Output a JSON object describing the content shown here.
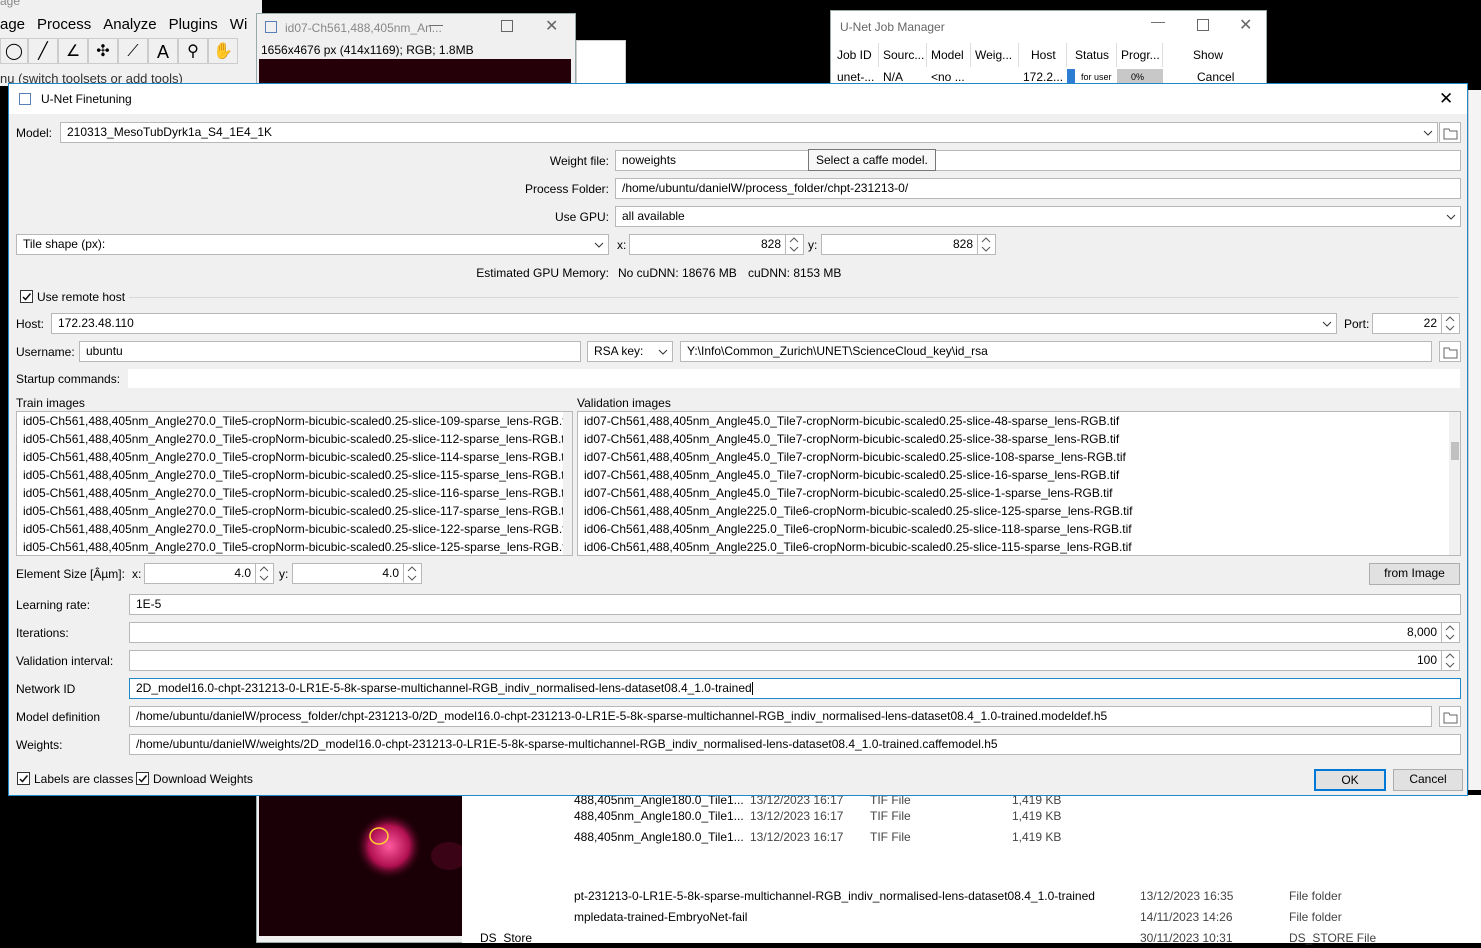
{
  "imagej": {
    "title": "age",
    "menu": [
      "age",
      "Process",
      "Analyze",
      "Plugins",
      "Wi"
    ],
    "status": "nu (switch toolsets or add tools)"
  },
  "image_window": {
    "title": "id07-Ch561,488,405nm_An...",
    "info": "1656x4676 px (414x1169); RGB; 1.8MB"
  },
  "job_manager": {
    "title": "U-Net Job Manager",
    "columns": [
      "Job ID",
      "Sourc...",
      "Model",
      "Weig...",
      "Host",
      "Status",
      "Progr...",
      "Show"
    ],
    "row": [
      "unet-...",
      "N/A",
      "<no ...",
      "",
      "172.2...",
      "for user",
      "0%",
      "Cancel"
    ]
  },
  "file_explorer": {
    "rows": [
      {
        "name": "488,405nm_Angle180.0_Tile1...",
        "date": "13/12/2023 16:17",
        "type": "TIF File",
        "size": "1,419 KB"
      },
      {
        "name": "488,405nm_Angle180.0_Tile1...",
        "date": "13/12/2023 16:17",
        "type": "TIF File",
        "size": "1,419 KB"
      },
      {
        "name": "488,405nm_Angle180.0_Tile1...",
        "date": "13/12/2023 16:17",
        "type": "TIF File",
        "size": "1,419 KB"
      }
    ],
    "folders": [
      {
        "name": "pt-231213-0-LR1E-5-8k-sparse-multichannel-RGB_indiv_normalised-lens-dataset08.4_1.0-trained",
        "date": "13/12/2023 16:35",
        "type": "File folder"
      },
      {
        "name": "mpledata-trained-EmbryoNet-fail",
        "date": "14/11/2023 14:26",
        "type": "File folder"
      },
      {
        "name": "DS_Store",
        "date": "30/11/2023 10:31",
        "type": "DS_STORE File"
      }
    ]
  },
  "dialog": {
    "title": "U-Net Finetuning",
    "model_label": "Model:",
    "model_value": "210313_MesoTubDyrk1a_S4_1E4_1K",
    "weight_file_label": "Weight file:",
    "weight_file_value": "noweights",
    "tooltip": "Select a caffe model.",
    "process_folder_label": "Process Folder:",
    "process_folder_value": "/home/ubuntu/danielW/process_folder/chpt-231213-0/",
    "use_gpu_label": "Use GPU:",
    "use_gpu_value": "all available",
    "tile_shape_value": "Tile shape (px):",
    "x_label": "x:",
    "y_label": "y:",
    "tile_x": "828",
    "tile_y": "828",
    "gpu_memory_label": "Estimated GPU Memory:",
    "gpu_nocudnn": "No cuDNN: 18676 MB",
    "gpu_cudnn": "cuDNN: 8153 MB",
    "use_remote_host_label": "Use remote host",
    "host_label": "Host:",
    "host_value": "172.23.48.110",
    "port_label": "Port:",
    "port_value": "22",
    "username_label": "Username:",
    "username_value": "ubuntu",
    "rsa_key_value": "RSA key:",
    "rsa_path": "Y:\\Info\\Common_Zurich\\UNET\\ScienceCloud_key\\id_rsa",
    "startup_label": "Startup commands:",
    "train_images_label": "Train images",
    "train_images": [
      "id05-Ch561,488,405nm_Angle270.0_Tile5-cropNorm-bicubic-scaled0.25-slice-109-sparse_lens-RGB.tif",
      "id05-Ch561,488,405nm_Angle270.0_Tile5-cropNorm-bicubic-scaled0.25-slice-112-sparse_lens-RGB.tif",
      "id05-Ch561,488,405nm_Angle270.0_Tile5-cropNorm-bicubic-scaled0.25-slice-114-sparse_lens-RGB.tif",
      "id05-Ch561,488,405nm_Angle270.0_Tile5-cropNorm-bicubic-scaled0.25-slice-115-sparse_lens-RGB.tif",
      "id05-Ch561,488,405nm_Angle270.0_Tile5-cropNorm-bicubic-scaled0.25-slice-116-sparse_lens-RGB.tif",
      "id05-Ch561,488,405nm_Angle270.0_Tile5-cropNorm-bicubic-scaled0.25-slice-117-sparse_lens-RGB.tif",
      "id05-Ch561,488,405nm_Angle270.0_Tile5-cropNorm-bicubic-scaled0.25-slice-122-sparse_lens-RGB.tif",
      "id05-Ch561,488,405nm_Angle270.0_Tile5-cropNorm-bicubic-scaled0.25-slice-125-sparse_lens-RGB.tif"
    ],
    "validation_images_label": "Validation images",
    "validation_images": [
      "id07-Ch561,488,405nm_Angle45.0_Tile7-cropNorm-bicubic-scaled0.25-slice-48-sparse_lens-RGB.tif",
      "id07-Ch561,488,405nm_Angle45.0_Tile7-cropNorm-bicubic-scaled0.25-slice-38-sparse_lens-RGB.tif",
      "id07-Ch561,488,405nm_Angle45.0_Tile7-cropNorm-bicubic-scaled0.25-slice-108-sparse_lens-RGB.tif",
      "id07-Ch561,488,405nm_Angle45.0_Tile7-cropNorm-bicubic-scaled0.25-slice-16-sparse_lens-RGB.tif",
      "id07-Ch561,488,405nm_Angle45.0_Tile7-cropNorm-bicubic-scaled0.25-slice-1-sparse_lens-RGB.tif",
      "id06-Ch561,488,405nm_Angle225.0_Tile6-cropNorm-bicubic-scaled0.25-slice-125-sparse_lens-RGB.tif",
      "id06-Ch561,488,405nm_Angle225.0_Tile6-cropNorm-bicubic-scaled0.25-slice-118-sparse_lens-RGB.tif",
      "id06-Ch561,488,405nm_Angle225.0_Tile6-cropNorm-bicubic-scaled0.25-slice-115-sparse_lens-RGB.tif"
    ],
    "element_size_label": "Element Size [Âµm]:",
    "element_x": "4.0",
    "element_y": "4.0",
    "from_image": "from Image",
    "learning_rate_label": "Learning rate:",
    "learning_rate": "1E-5",
    "iterations_label": "Iterations:",
    "iterations": "8,000",
    "validation_interval_label": "Validation interval:",
    "validation_interval": "100",
    "network_id_label": "Network ID",
    "network_id": "2D_model16.0-chpt-231213-0-LR1E-5-8k-sparse-multichannel-RGB_indiv_normalised-lens-dataset08.4_1.0-trained",
    "model_def_label": "Model definition",
    "model_def": "/home/ubuntu/danielW/process_folder/chpt-231213-0/2D_model16.0-chpt-231213-0-LR1E-5-8k-sparse-multichannel-RGB_indiv_normalised-lens-dataset08.4_1.0-trained.modeldef.h5",
    "weights_label": "Weights:",
    "weights": "/home/ubuntu/danielW/weights/2D_model16.0-chpt-231213-0-LR1E-5-8k-sparse-multichannel-RGB_indiv_normalised-lens-dataset08.4_1.0-trained.caffemodel.h5",
    "labels_are_classes": "Labels are classes",
    "download_weights": "Download Weights",
    "ok": "OK",
    "cancel": "Cancel"
  }
}
